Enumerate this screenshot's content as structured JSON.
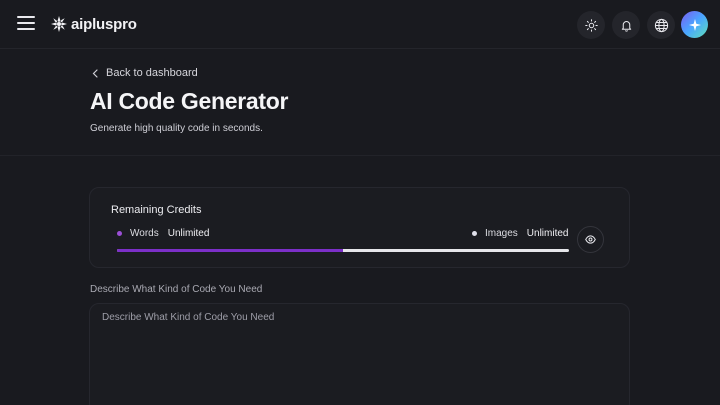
{
  "brand": {
    "name": "aipluspro"
  },
  "topbar": {
    "icons": [
      "menu-icon",
      "sun-icon",
      "bell-icon",
      "globe-icon",
      "sparkle-icon"
    ]
  },
  "header": {
    "back_label": "Back to dashboard",
    "title": "AI Code Generator",
    "subtitle": "Generate high quality code in seconds."
  },
  "credits": {
    "title": "Remaining Credits",
    "words_label": "Words",
    "words_value": "Unlimited",
    "images_label": "Images",
    "images_value": "Unlimited",
    "words_fill_fraction": 0.5,
    "colors": {
      "words": "#9b4fd6",
      "images": "#e0e0ea",
      "fill": "#7c2fc8"
    }
  },
  "form": {
    "label": "Describe What Kind of Code You Need",
    "placeholder": "Describe What Kind of Code You Need"
  }
}
